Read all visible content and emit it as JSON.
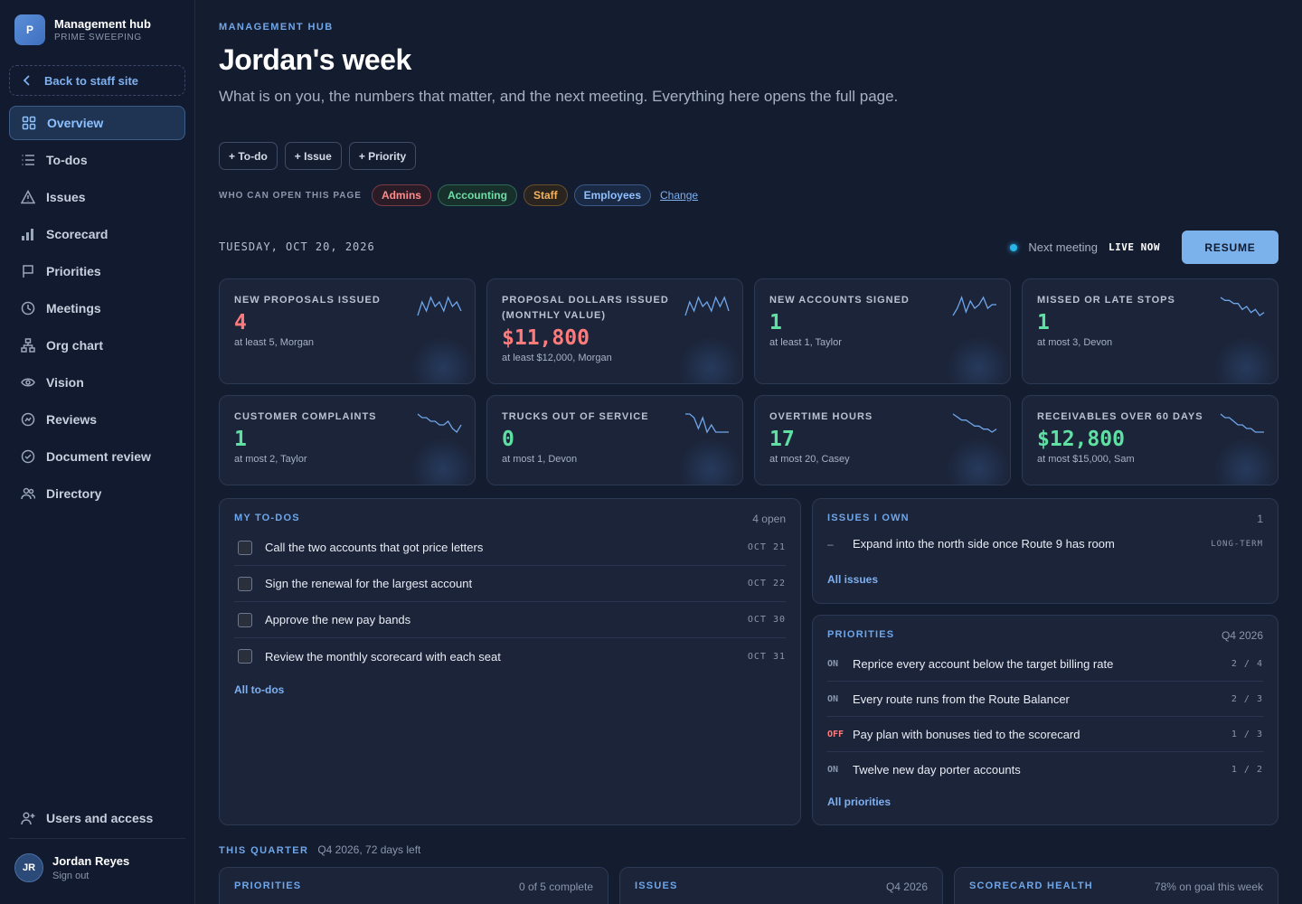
{
  "brand": {
    "logo_letter": "P",
    "title": "Management hub",
    "subtitle": "PRIME SWEEPING"
  },
  "sidebar": {
    "back_label": "Back to staff site",
    "items": [
      {
        "label": "Overview",
        "icon": "grid-icon",
        "active": true
      },
      {
        "label": "To-dos",
        "icon": "list-icon"
      },
      {
        "label": "Issues",
        "icon": "warning-icon"
      },
      {
        "label": "Scorecard",
        "icon": "bar-chart-icon"
      },
      {
        "label": "Priorities",
        "icon": "flag-icon"
      },
      {
        "label": "Meetings",
        "icon": "clock-icon"
      },
      {
        "label": "Org chart",
        "icon": "org-chart-icon"
      },
      {
        "label": "Vision",
        "icon": "eye-icon"
      },
      {
        "label": "Reviews",
        "icon": "review-icon"
      },
      {
        "label": "Document review",
        "icon": "check-circle-icon"
      },
      {
        "label": "Directory",
        "icon": "people-icon"
      }
    ],
    "users_access_label": "Users and access",
    "user": {
      "initials": "JR",
      "name": "Jordan Reyes",
      "signout": "Sign out"
    }
  },
  "header": {
    "eyebrow": "MANAGEMENT HUB",
    "title": "Jordan's week",
    "lede": "What is on you, the numbers that matter, and the next meeting. Everything here opens the full page.",
    "quick_actions": [
      "+ To-do",
      "+ Issue",
      "+ Priority"
    ],
    "access_label": "WHO CAN OPEN THIS PAGE",
    "access_chips": [
      "Admins",
      "Accounting",
      "Staff",
      "Employees"
    ],
    "change_label": "Change"
  },
  "date_line": "TUESDAY, OCT 20, 2026",
  "meeting": {
    "label": "Next meeting",
    "status": "LIVE NOW",
    "button": "RESUME",
    "dot_color": "#29b6e8"
  },
  "metrics": [
    {
      "label": "NEW PROPOSALS ISSUED",
      "value": "4",
      "tone": "red",
      "goal": "at least 5, Morgan",
      "trend": [
        3,
        6,
        4,
        7,
        5,
        6,
        4,
        7,
        5,
        6,
        4
      ]
    },
    {
      "label": "PROPOSAL DOLLARS ISSUED (MONTHLY VALUE)",
      "value": "$11,800",
      "tone": "red",
      "goal": "at least $12,000, Morgan",
      "trend": [
        3,
        6,
        4,
        7,
        5,
        6,
        4,
        7,
        5,
        7,
        4
      ]
    },
    {
      "label": "NEW ACCOUNTS SIGNED",
      "value": "1",
      "tone": "green",
      "goal": "at least 1, Taylor",
      "trend": [
        2,
        4,
        7,
        3,
        6,
        4,
        5,
        7,
        4,
        5,
        5
      ]
    },
    {
      "label": "MISSED OR LATE STOPS",
      "value": "1",
      "tone": "green",
      "goal": "at most 3, Devon",
      "trend": [
        8,
        7,
        7,
        6,
        6,
        4,
        5,
        3,
        4,
        2,
        3
      ]
    },
    {
      "label": "CUSTOMER COMPLAINTS",
      "value": "1",
      "tone": "green",
      "goal": "at most 2, Taylor",
      "trend": [
        8,
        7,
        7,
        6,
        6,
        5,
        5,
        6,
        4,
        3,
        5
      ]
    },
    {
      "label": "TRUCKS OUT OF SERVICE",
      "value": "0",
      "tone": "green",
      "goal": "at most 1, Devon",
      "trend": [
        8,
        8,
        7,
        4,
        7,
        3,
        5,
        3,
        3,
        3,
        3
      ]
    },
    {
      "label": "OVERTIME HOURS",
      "value": "17",
      "tone": "green",
      "goal": "at most 20, Casey",
      "trend": [
        8,
        7,
        6,
        6,
        5,
        4,
        4,
        3,
        3,
        2,
        3
      ]
    },
    {
      "label": "RECEIVABLES OVER 60 DAYS",
      "value": "$12,800",
      "tone": "green",
      "goal": "at most $15,000, Sam",
      "trend": [
        8,
        7,
        7,
        6,
        5,
        5,
        4,
        4,
        3,
        3,
        3
      ]
    }
  ],
  "todos": {
    "title": "MY TO-DOS",
    "meta": "4 open",
    "items": [
      {
        "text": "Call the two accounts that got price letters",
        "date": "OCT 21"
      },
      {
        "text": "Sign the renewal for the largest account",
        "date": "OCT 22"
      },
      {
        "text": "Approve the new pay bands",
        "date": "OCT 30"
      },
      {
        "text": "Review the monthly scorecard with each seat",
        "date": "OCT 31"
      }
    ],
    "link": "All to-dos"
  },
  "issues": {
    "title": "ISSUES I OWN",
    "meta": "1",
    "items": [
      {
        "marker": "–",
        "text": "Expand into the north side once Route 9 has room",
        "tag": "LONG-TERM"
      }
    ],
    "link": "All issues"
  },
  "priorities": {
    "title": "PRIORITIES",
    "meta": "Q4 2026",
    "items": [
      {
        "status": "ON",
        "text": "Reprice every account below the target billing rate",
        "count": "2 / 4"
      },
      {
        "status": "ON",
        "text": "Every route runs from the Route Balancer",
        "count": "2 / 3"
      },
      {
        "status": "OFF",
        "text": "Pay plan with bonuses tied to the scorecard",
        "count": "1 / 3"
      },
      {
        "status": "ON",
        "text": "Twelve new day porter accounts",
        "count": "1 / 2"
      }
    ],
    "link": "All priorities"
  },
  "quarter": {
    "title": "THIS QUARTER",
    "meta": "Q4 2026, 72 days left",
    "cards": [
      {
        "title": "PRIORITIES",
        "meta": "0 of 5 complete"
      },
      {
        "title": "ISSUES",
        "meta": "Q4 2026"
      },
      {
        "title": "SCORECARD HEALTH",
        "meta": "78% on goal this week"
      }
    ]
  },
  "colors": {
    "accent": "#6fa6ea",
    "good": "#5ee0a2",
    "bad": "#ff7b7b",
    "spark": "#6fa6ea"
  }
}
